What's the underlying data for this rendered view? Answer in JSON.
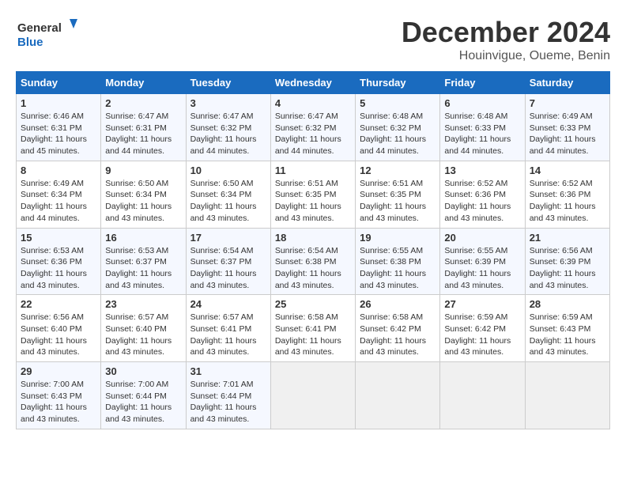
{
  "header": {
    "logo_line1": "General",
    "logo_line2": "Blue",
    "month": "December 2024",
    "location": "Houinvigue, Oueme, Benin"
  },
  "days_of_week": [
    "Sunday",
    "Monday",
    "Tuesday",
    "Wednesday",
    "Thursday",
    "Friday",
    "Saturday"
  ],
  "weeks": [
    [
      {
        "day": 1,
        "sunrise": "6:46 AM",
        "sunset": "6:31 PM",
        "daylight": "11 hours and 45 minutes"
      },
      {
        "day": 2,
        "sunrise": "6:47 AM",
        "sunset": "6:31 PM",
        "daylight": "11 hours and 44 minutes"
      },
      {
        "day": 3,
        "sunrise": "6:47 AM",
        "sunset": "6:32 PM",
        "daylight": "11 hours and 44 minutes"
      },
      {
        "day": 4,
        "sunrise": "6:47 AM",
        "sunset": "6:32 PM",
        "daylight": "11 hours and 44 minutes"
      },
      {
        "day": 5,
        "sunrise": "6:48 AM",
        "sunset": "6:32 PM",
        "daylight": "11 hours and 44 minutes"
      },
      {
        "day": 6,
        "sunrise": "6:48 AM",
        "sunset": "6:33 PM",
        "daylight": "11 hours and 44 minutes"
      },
      {
        "day": 7,
        "sunrise": "6:49 AM",
        "sunset": "6:33 PM",
        "daylight": "11 hours and 44 minutes"
      }
    ],
    [
      {
        "day": 8,
        "sunrise": "6:49 AM",
        "sunset": "6:34 PM",
        "daylight": "11 hours and 44 minutes"
      },
      {
        "day": 9,
        "sunrise": "6:50 AM",
        "sunset": "6:34 PM",
        "daylight": "11 hours and 43 minutes"
      },
      {
        "day": 10,
        "sunrise": "6:50 AM",
        "sunset": "6:34 PM",
        "daylight": "11 hours and 43 minutes"
      },
      {
        "day": 11,
        "sunrise": "6:51 AM",
        "sunset": "6:35 PM",
        "daylight": "11 hours and 43 minutes"
      },
      {
        "day": 12,
        "sunrise": "6:51 AM",
        "sunset": "6:35 PM",
        "daylight": "11 hours and 43 minutes"
      },
      {
        "day": 13,
        "sunrise": "6:52 AM",
        "sunset": "6:36 PM",
        "daylight": "11 hours and 43 minutes"
      },
      {
        "day": 14,
        "sunrise": "6:52 AM",
        "sunset": "6:36 PM",
        "daylight": "11 hours and 43 minutes"
      }
    ],
    [
      {
        "day": 15,
        "sunrise": "6:53 AM",
        "sunset": "6:36 PM",
        "daylight": "11 hours and 43 minutes"
      },
      {
        "day": 16,
        "sunrise": "6:53 AM",
        "sunset": "6:37 PM",
        "daylight": "11 hours and 43 minutes"
      },
      {
        "day": 17,
        "sunrise": "6:54 AM",
        "sunset": "6:37 PM",
        "daylight": "11 hours and 43 minutes"
      },
      {
        "day": 18,
        "sunrise": "6:54 AM",
        "sunset": "6:38 PM",
        "daylight": "11 hours and 43 minutes"
      },
      {
        "day": 19,
        "sunrise": "6:55 AM",
        "sunset": "6:38 PM",
        "daylight": "11 hours and 43 minutes"
      },
      {
        "day": 20,
        "sunrise": "6:55 AM",
        "sunset": "6:39 PM",
        "daylight": "11 hours and 43 minutes"
      },
      {
        "day": 21,
        "sunrise": "6:56 AM",
        "sunset": "6:39 PM",
        "daylight": "11 hours and 43 minutes"
      }
    ],
    [
      {
        "day": 22,
        "sunrise": "6:56 AM",
        "sunset": "6:40 PM",
        "daylight": "11 hours and 43 minutes"
      },
      {
        "day": 23,
        "sunrise": "6:57 AM",
        "sunset": "6:40 PM",
        "daylight": "11 hours and 43 minutes"
      },
      {
        "day": 24,
        "sunrise": "6:57 AM",
        "sunset": "6:41 PM",
        "daylight": "11 hours and 43 minutes"
      },
      {
        "day": 25,
        "sunrise": "6:58 AM",
        "sunset": "6:41 PM",
        "daylight": "11 hours and 43 minutes"
      },
      {
        "day": 26,
        "sunrise": "6:58 AM",
        "sunset": "6:42 PM",
        "daylight": "11 hours and 43 minutes"
      },
      {
        "day": 27,
        "sunrise": "6:59 AM",
        "sunset": "6:42 PM",
        "daylight": "11 hours and 43 minutes"
      },
      {
        "day": 28,
        "sunrise": "6:59 AM",
        "sunset": "6:43 PM",
        "daylight": "11 hours and 43 minutes"
      }
    ],
    [
      {
        "day": 29,
        "sunrise": "7:00 AM",
        "sunset": "6:43 PM",
        "daylight": "11 hours and 43 minutes"
      },
      {
        "day": 30,
        "sunrise": "7:00 AM",
        "sunset": "6:44 PM",
        "daylight": "11 hours and 43 minutes"
      },
      {
        "day": 31,
        "sunrise": "7:01 AM",
        "sunset": "6:44 PM",
        "daylight": "11 hours and 43 minutes"
      },
      null,
      null,
      null,
      null
    ]
  ]
}
